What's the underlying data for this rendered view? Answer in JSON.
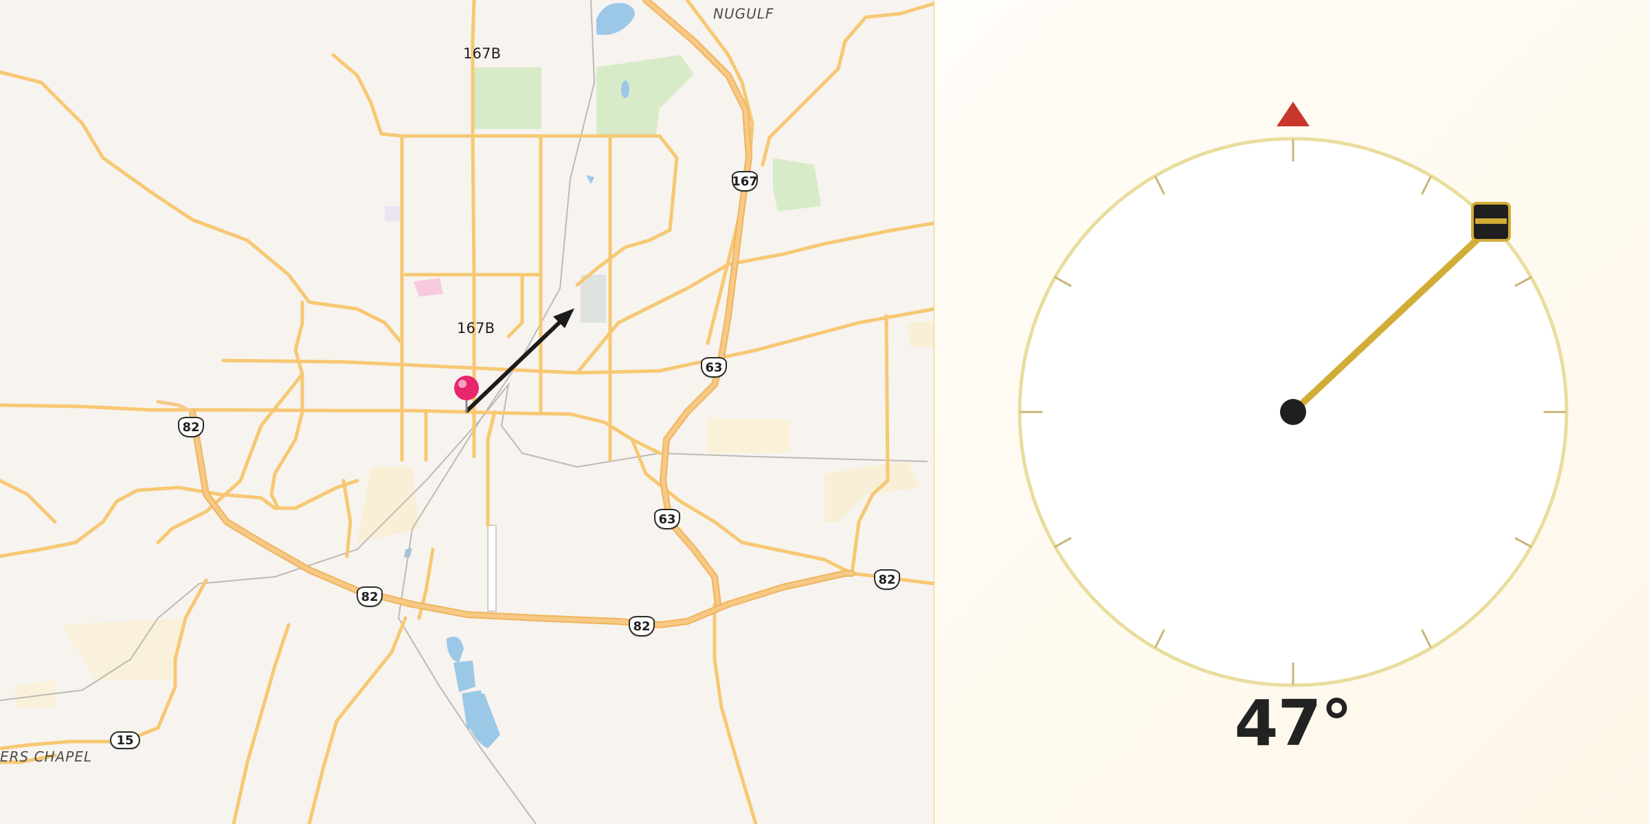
{
  "map": {
    "place_labels": {
      "town_north": "NUGULF",
      "town_southwest": "ERS CHAPEL",
      "junction_north": "167B",
      "junction_center": "167B"
    },
    "route_shields": {
      "us82_west": "82",
      "us167": "167",
      "us63_north": "63",
      "us63_south": "63",
      "us82_southwest": "82",
      "us82_south": "82",
      "us82_east": "82",
      "state15": "15"
    },
    "marker": {
      "icon": "map-pin-icon",
      "color": "#e8266b"
    },
    "direction_arrow": {
      "icon": "direction-arrow-icon",
      "color": "#1c1c1c"
    },
    "colors": {
      "land": "#f7f3ef",
      "road": "#f7c873",
      "highway": "#f4b85f",
      "park": "#d8ebc8",
      "water": "#9cc8e8"
    }
  },
  "compass": {
    "bearing_value": 47,
    "bearing_label": "47°",
    "north_icon": "north-triangle-icon",
    "needle_handle_icon": "drag-handle-icon",
    "colors": {
      "ring": "#e9dd9e",
      "ticks": "#c9b57a",
      "north": "#c8372d",
      "needle": "#d1ad38",
      "handle": "#1f1f1f",
      "center": "#1f1f1f"
    }
  }
}
